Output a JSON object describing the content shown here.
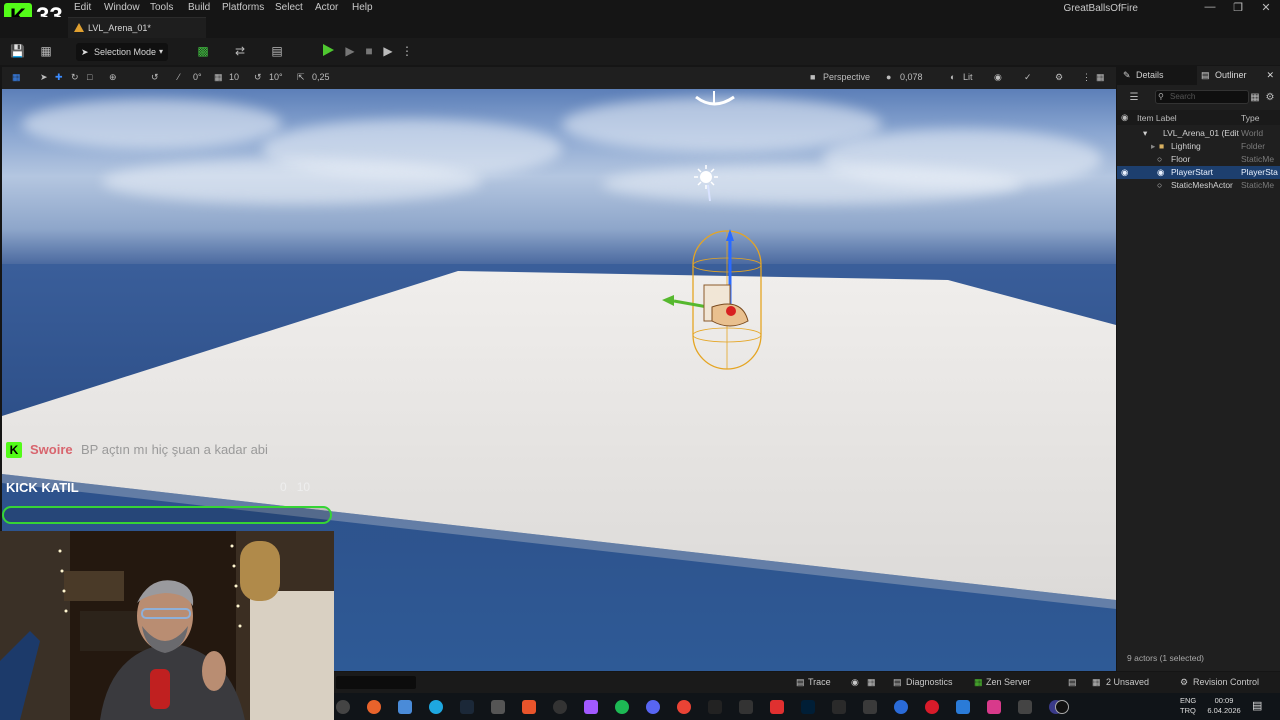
{
  "stream": {
    "logo_letter": "K",
    "badge_number": "33",
    "chat": {
      "user": "Swoire",
      "message": "BP açtın mı hiç şuan a kadar abi"
    },
    "kick_goal": {
      "title": "KICK KATIL",
      "current": "0",
      "target": "10",
      "progress_fraction": 0.0,
      "color": "#36d436"
    }
  },
  "menu": {
    "items": [
      "Edit",
      "Window",
      "Tools",
      "Build",
      "Platforms",
      "Select",
      "Actor",
      "Help"
    ]
  },
  "window": {
    "title": "GreatBallsOfFire",
    "minimize_icon": "minimize-icon",
    "maximize_icon": "restore-icon",
    "close_icon": "close-icon"
  },
  "tab": {
    "level_name": "LVL_Arena_01*"
  },
  "toolbar": {
    "mode_label": "Selection Mode",
    "play_color": "#4fc830"
  },
  "viewport_toolbar": {
    "grid_snap": "0°",
    "translate_snap": "10",
    "rotation_snap": "10°",
    "scale_snap": "0,25",
    "view_mode": "Perspective",
    "camera_speed": "0,078",
    "lit_mode": "Lit"
  },
  "right_panel": {
    "tab_details": "Details",
    "tab_outliner": "Outliner",
    "search_placeholder": "Search",
    "col_label": "Item Label",
    "col_type": "Type",
    "rows": [
      {
        "label": "LVL_Arena_01 (Edit",
        "type": "World"
      },
      {
        "label": "Lighting",
        "type": "Folder"
      },
      {
        "label": "Floor",
        "type": "StaticMe"
      },
      {
        "label": "PlayerStart",
        "type": "PlayerSta"
      },
      {
        "label": "StaticMeshActor",
        "type": "StaticMe"
      }
    ],
    "footer": "9 actors (1 selected)"
  },
  "bottom_bar": {
    "trace": "Trace",
    "diagnostics": "Diagnostics",
    "zen_server": "Zen Server",
    "unsaved": "2 Unsaved",
    "revision_control": "Revision Control"
  },
  "taskbar": {
    "lang_top": "ENG",
    "lang_bottom": "TRQ",
    "time": "00:09",
    "date": "6.04.2026"
  }
}
